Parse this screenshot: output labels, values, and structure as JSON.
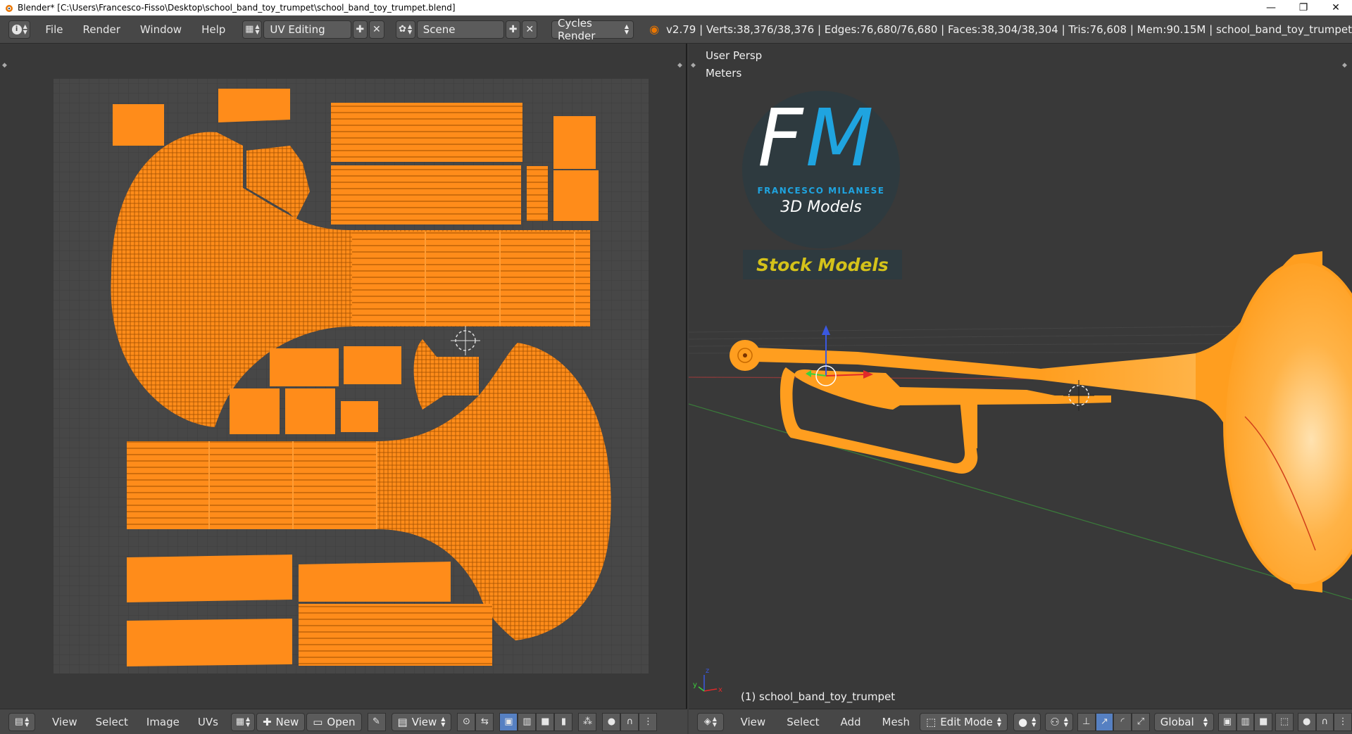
{
  "window": {
    "title": "Blender* [C:\\Users\\Francesco-Fisso\\Desktop\\school_band_toy_trumpet\\school_band_toy_trumpet.blend]",
    "minimize": "—",
    "maximize": "❐",
    "close": "✕"
  },
  "info_header": {
    "menus": [
      "File",
      "Render",
      "Window",
      "Help"
    ],
    "screen_layout": "UV Editing",
    "scene": "Scene",
    "render_engine": "Cycles Render",
    "stats": "v2.79 | Verts:38,376/38,376 | Edges:76,680/76,680 | Faces:38,304/38,304 | Tris:76,608 | Mem:90.15M | school_band_toy_trumpet"
  },
  "uv_editor": {
    "menus": [
      "View",
      "Select",
      "Image",
      "UVs"
    ],
    "new_label": "New",
    "open_label": "Open",
    "view_label": "View"
  },
  "viewport": {
    "view_name": "User Persp",
    "units": "Meters",
    "object_label": "(1) school_band_toy_trumpet",
    "menus": [
      "View",
      "Select",
      "Add",
      "Mesh"
    ],
    "mode": "Edit Mode",
    "orientation": "Global"
  },
  "logo": {
    "initials_f": "F",
    "initials_m": "M",
    "company": "FRANCESCO MILANESE",
    "tagline": "3D Models",
    "badge": "Stock Models"
  },
  "colors": {
    "uv_orange": "#ff8c1a",
    "selected_orange": "#ffa31f",
    "logo_blue": "#1fa4e0",
    "badge_yellow": "#d4c21a"
  }
}
